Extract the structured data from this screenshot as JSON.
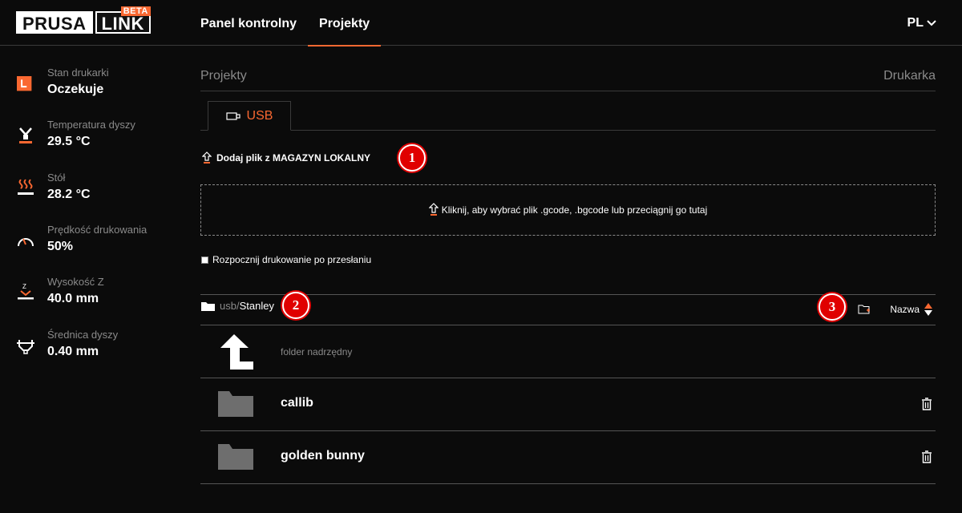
{
  "header": {
    "logo_left": "PRUSA",
    "logo_right": "LINK",
    "logo_badge": "BETA",
    "nav": [
      {
        "label": "Panel kontrolny",
        "active": false
      },
      {
        "label": "Projekty",
        "active": true
      }
    ],
    "language": "PL",
    "accent": "#fa6831"
  },
  "sidebar": {
    "items": [
      {
        "label": "Stan drukarki",
        "value": "Oczekuje",
        "icon": "printer-state-icon"
      },
      {
        "label": "Temperatura dyszy",
        "value": "29.5 °C",
        "icon": "nozzle-temperature-icon"
      },
      {
        "label": "Stół",
        "value": "28.2 °C",
        "icon": "heatbed-icon"
      },
      {
        "label": "Prędkość drukowania",
        "value": "50%",
        "icon": "speed-gauge-icon"
      },
      {
        "label": "Wysokość Z",
        "value": "40.0 mm",
        "icon": "z-height-icon"
      },
      {
        "label": "Średnica dyszy",
        "value": "0.40 mm",
        "icon": "nozzle-diameter-icon"
      }
    ]
  },
  "main": {
    "breadcrumb_left": "Projekty",
    "breadcrumb_right": "Drukarka",
    "tab": "USB",
    "upload_title": "Dodaj plik z MAGAZYN LOKALNY",
    "dropzone_text": "Kliknij, aby wybrać plik .gcode, .bgcode lub przeciągnij go tutaj",
    "autostart_label": "Rozpocznij drukowanie po przesłaniu",
    "path_prefix": "usb/",
    "path_current": "Stanley",
    "sort_label": "Nazwa",
    "parent_folder": "folder nadrzędny",
    "folders": [
      "callib",
      "golden bunny"
    ]
  },
  "markers": [
    "1",
    "2",
    "3"
  ],
  "marker_color": "#e00000"
}
